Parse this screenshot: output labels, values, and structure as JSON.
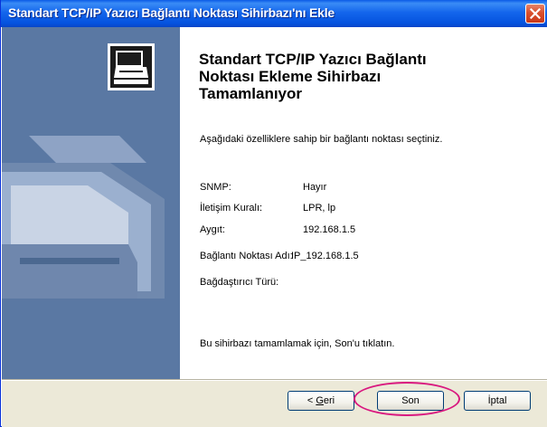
{
  "window": {
    "title": "Standart TCP/IP Yazıcı Bağlantı Noktası Sihirbazı'nı Ekle",
    "close_icon": "close-icon",
    "accent_color": "#0a5ae6"
  },
  "sidebar": {
    "icon": "printer-icon",
    "color": "#5a78a3"
  },
  "main": {
    "heading_line1": "Standart TCP/IP Yazıcı Bağlantı",
    "heading_line2": "Noktası Ekleme Sihirbazı",
    "heading_line3": "Tamamlanıyor",
    "intro": "Aşağıdaki özelliklere sahip bir bağlantı noktası seçtiniz.",
    "properties": [
      {
        "label": "SNMP:",
        "value": "Hayır"
      },
      {
        "label": "İletişim Kuralı:",
        "value": "LPR, lp"
      },
      {
        "label": "Aygıt:",
        "value": "192.168.1.5"
      },
      {
        "label": "Bağlantı Noktası Adı:",
        "value": "IP_192.168.1.5"
      },
      {
        "label": "Bağdaştırıcı Türü:",
        "value": ""
      }
    ],
    "finish_text": "Bu sihirbazı tamamlamak için, Son'u tıklatın."
  },
  "buttons": {
    "back_prefix": "< ",
    "back_key": "G",
    "back_rest": "eri",
    "finish": "Son",
    "cancel": "İptal"
  },
  "highlight_color": "#d9187f"
}
